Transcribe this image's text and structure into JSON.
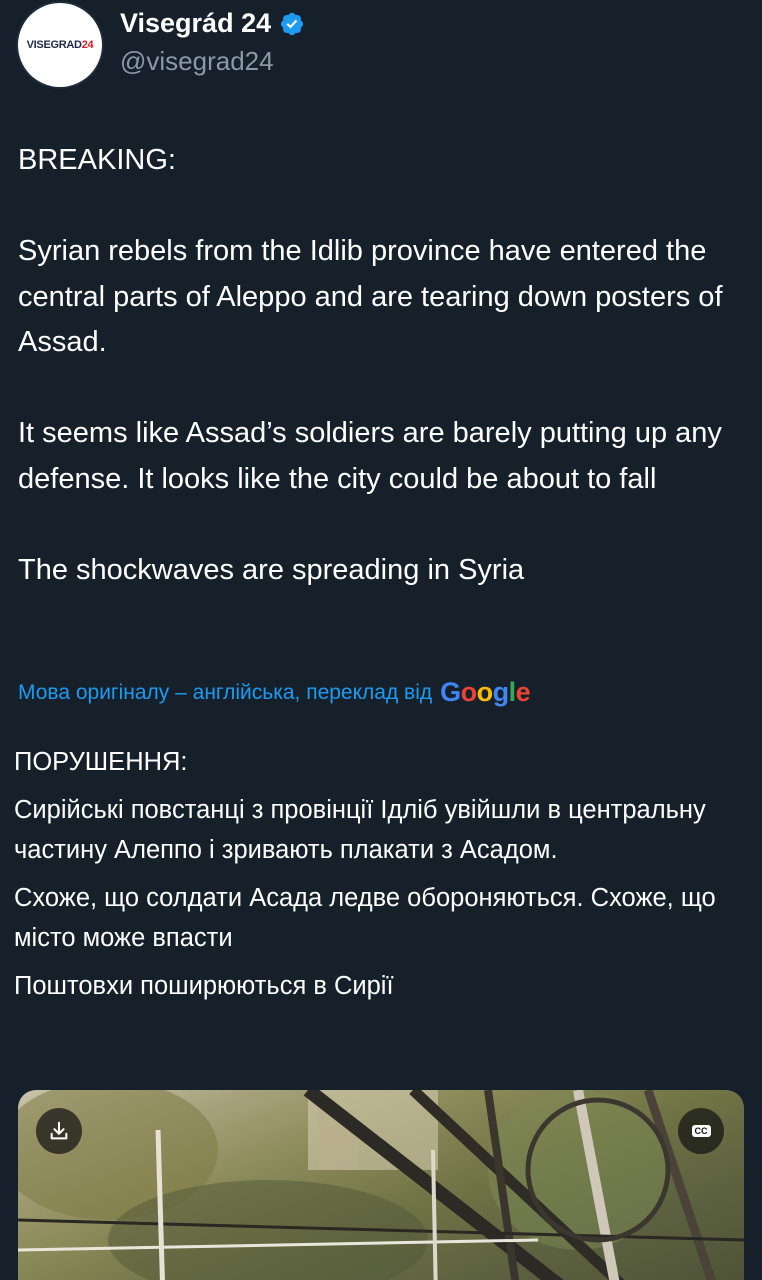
{
  "author": {
    "display_name": "Visegrád 24",
    "handle": "@visegrad24",
    "avatar_logo_text": "VISEGRAD",
    "avatar_logo_number": "24",
    "verified": true,
    "verified_color": "#1d9bf0"
  },
  "tweet": {
    "paragraphs": [
      "BREAKING:",
      "Syrian rebels from the Idlib province have entered the central parts of Aleppo and are tearing down posters of Assad.",
      "It seems like Assad’s soldiers are barely putting up any defense. It looks like the city could be about to fall",
      "The shockwaves are spreading in Syria"
    ]
  },
  "translation": {
    "link_text": "Мова оригіналу – англійська, переклад від",
    "provider_letters": [
      "G",
      "o",
      "o",
      "g",
      "l",
      "e"
    ],
    "paragraphs": [
      "ПОРУШЕННЯ:",
      "Сирійські повстанці з провінції Ідліб увійшли в центральну частину Алеппо і зривають плакати з Асадом.",
      "Схоже, що солдати Асада ледве обороняються. Схоже, що місто може впасти",
      "Поштовхи поширюються в Сирії"
    ]
  },
  "media": {
    "type": "video",
    "cc_label": "CC",
    "icons": [
      "download-icon",
      "closed-captions-icon"
    ]
  },
  "colors": {
    "background": "#15202b",
    "text": "#ffffff",
    "secondary_text": "#8b98a5",
    "link": "#1d9bf0"
  }
}
